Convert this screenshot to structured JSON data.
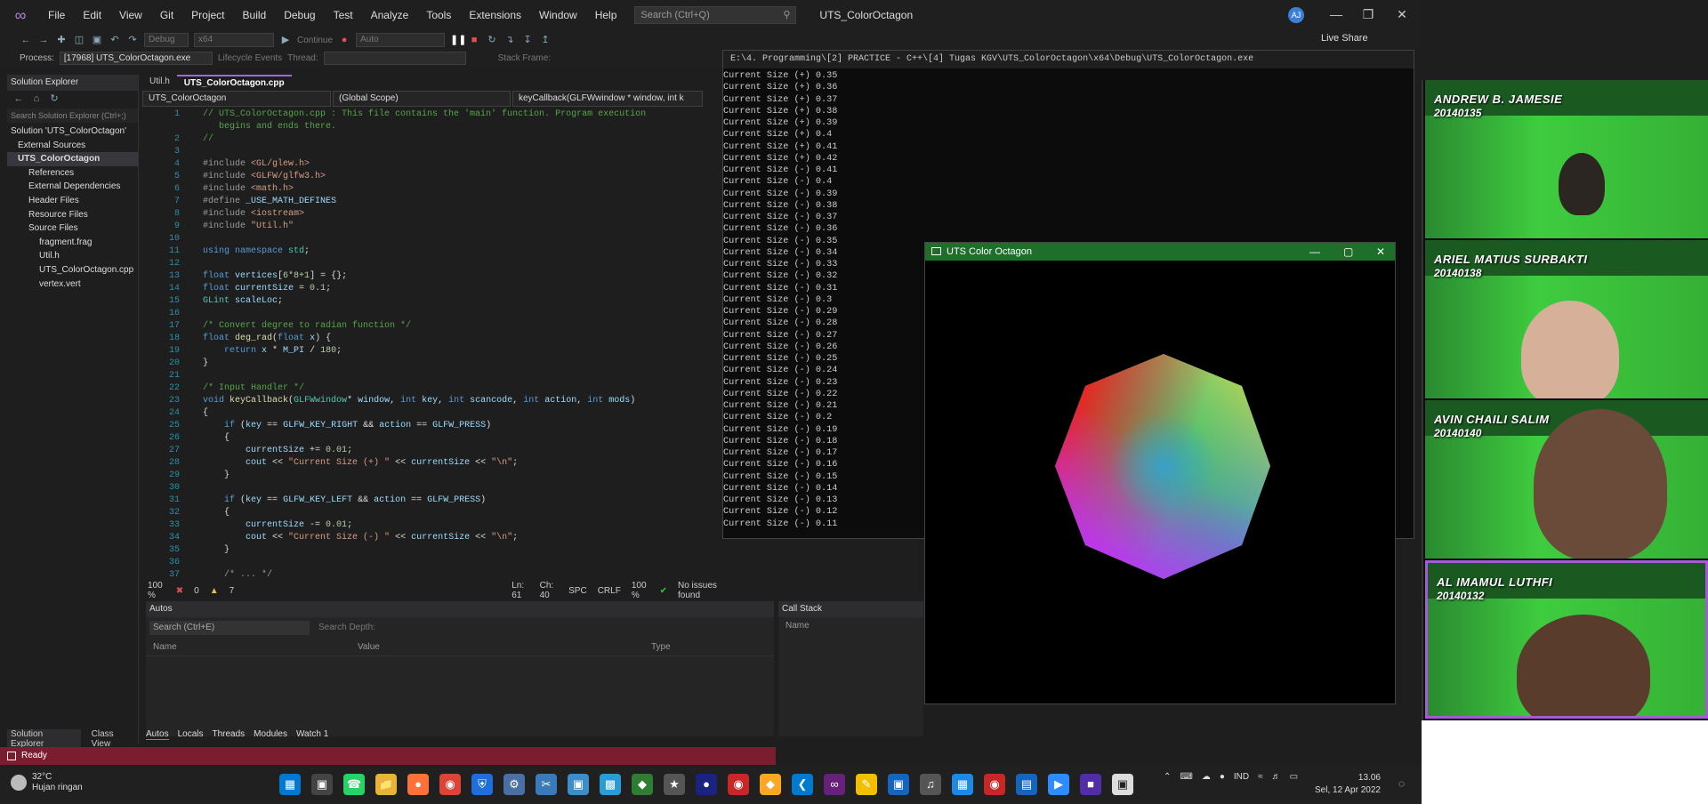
{
  "ide": {
    "menu": [
      "File",
      "Edit",
      "View",
      "Git",
      "Project",
      "Build",
      "Debug",
      "Test",
      "Analyze",
      "Tools",
      "Extensions",
      "Window",
      "Help"
    ],
    "search_placeholder": "Search (Ctrl+Q)",
    "solution_title": "UTS_ColorOctagon",
    "avatar_initials": "AJ",
    "live_share": "Live Share",
    "toolbar": {
      "config": "Debug",
      "platform": "x64",
      "continue": "Continue",
      "auto": "Auto"
    },
    "process_label": "Process:",
    "process_value": "[17968] UTS_ColorOctagon.exe",
    "lifecycle": "Lifecycle Events",
    "thread_label": "Thread:",
    "stack_frame": "Stack Frame:"
  },
  "solution_explorer": {
    "title": "Solution Explorer",
    "search": "Search Solution Explorer (Ctrl+;)",
    "tree": [
      "Solution 'UTS_ColorOctagon'",
      "External Sources",
      "UTS_ColorOctagon",
      "References",
      "External Dependencies",
      "Header Files",
      "Resource Files",
      "Source Files",
      "fragment.frag",
      "Util.h",
      "UTS_ColorOctagon.cpp",
      "vertex.vert"
    ],
    "tabs": [
      "Solution Explorer",
      "Class View"
    ]
  },
  "editor": {
    "tabs": [
      "Util.h",
      "UTS_ColorOctagon.cpp"
    ],
    "nav": [
      "UTS_ColorOctagon",
      "(Global Scope)",
      "keyCallback(GLFWwindow * window, int k"
    ],
    "status": {
      "zoom": "100 %",
      "errors": "0",
      "warnings": "7",
      "position": "Ln: 61",
      "col": "Ch: 40",
      "spc": "SPC",
      "crlf": "CRLF",
      "zoom2": "100 %",
      "issues": "No issues found"
    }
  },
  "autos": {
    "title": "Autos",
    "search": "Search (Ctrl+E)",
    "depth": "Search Depth:",
    "columns": [
      "Name",
      "Value",
      "Type"
    ],
    "tabs": [
      "Autos",
      "Locals",
      "Threads",
      "Modules",
      "Watch 1"
    ]
  },
  "callstack": {
    "title": "Call Stack",
    "column": "Name"
  },
  "console": {
    "title": "E:\\4. Programming\\[2] PRACTICE - C++\\[4] Tugas KGV\\UTS_ColorOctagon\\x64\\Debug\\UTS_ColorOctagon.exe",
    "lines": [
      "Current Size (+) 0.35",
      "Current Size (+) 0.36",
      "Current Size (+) 0.37",
      "Current Size (+) 0.38",
      "Current Size (+) 0.39",
      "Current Size (+) 0.4",
      "Current Size (+) 0.41",
      "Current Size (+) 0.42",
      "Current Size (-) 0.41",
      "Current Size (-) 0.4",
      "Current Size (-) 0.39",
      "Current Size (-) 0.38",
      "Current Size (-) 0.37",
      "Current Size (-) 0.36",
      "Current Size (-) 0.35",
      "Current Size (-) 0.34",
      "Current Size (-) 0.33",
      "Current Size (-) 0.32",
      "Current Size (-) 0.31",
      "Current Size (-) 0.3",
      "Current Size (-) 0.29",
      "Current Size (-) 0.28",
      "Current Size (-) 0.27",
      "Current Size (-) 0.26",
      "Current Size (-) 0.25",
      "Current Size (-) 0.24",
      "Current Size (-) 0.23",
      "Current Size (-) 0.22",
      "Current Size (-) 0.21",
      "Current Size (-) 0.2",
      "Current Size (-) 0.19",
      "Current Size (-) 0.18",
      "Current Size (-) 0.17",
      "Current Size (-) 0.16",
      "Current Size (-) 0.15",
      "Current Size (-) 0.14",
      "Current Size (-) 0.13",
      "Current Size (-) 0.12",
      "Current Size (-) 0.11"
    ]
  },
  "gl_window": {
    "title": "UTS Color Octagon"
  },
  "status_bar": {
    "text": "Ready"
  },
  "participants": [
    {
      "name": "ANDREW B. JAMESIE",
      "id": "20140135"
    },
    {
      "name": "ARIEL MATIUS SURBAKTI",
      "id": "20140138"
    },
    {
      "name": "AVIN CHAILI SALIM",
      "id": "20140140"
    },
    {
      "name": "AL IMAMUL LUTHFI",
      "id": "20140132"
    }
  ],
  "taskbar": {
    "temperature": "32°C",
    "weather": "Hujan ringan",
    "lang": "IND",
    "time": "13.06",
    "date": "Sel, 12 Apr 2022"
  }
}
